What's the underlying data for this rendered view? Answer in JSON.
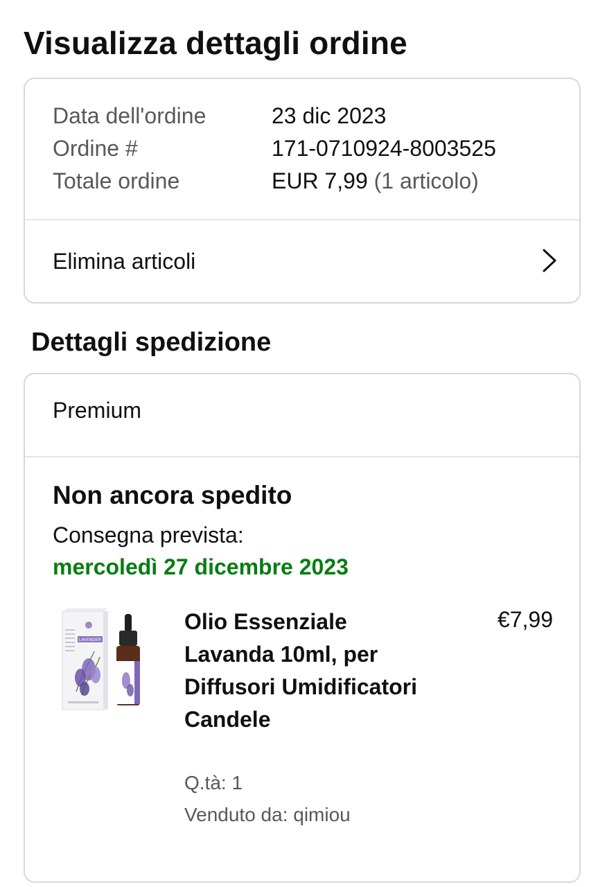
{
  "page_title": "Visualizza dettagli ordine",
  "order_summary": {
    "rows": [
      {
        "label": "Data dell'ordine",
        "value": "23 dic 2023",
        "sub": ""
      },
      {
        "label": "Ordine #",
        "value": "171-0710924-8003525",
        "sub": ""
      },
      {
        "label": "Totale ordine",
        "value": "EUR 7,99",
        "sub": " (1 articolo)"
      }
    ],
    "remove_items_label": "Elimina articoli",
    "remove_items_icon": "chevron-right-icon"
  },
  "shipping": {
    "section_title": "Dettagli spedizione",
    "method": "Premium",
    "status": "Non ancora spedito",
    "eta_label": "Consegna prevista:",
    "eta_date": "mercoledì 27 dicembre 2023",
    "eta_color": "#067d12",
    "item": {
      "title": "Olio Essenziale Lavanda 10ml, per Diffusori Umidificatori Candele",
      "price": "€7,99",
      "quantity": "Q.tà: 1",
      "seller": "Venduto da: qimiou",
      "image_label": "LAVENDER"
    }
  }
}
